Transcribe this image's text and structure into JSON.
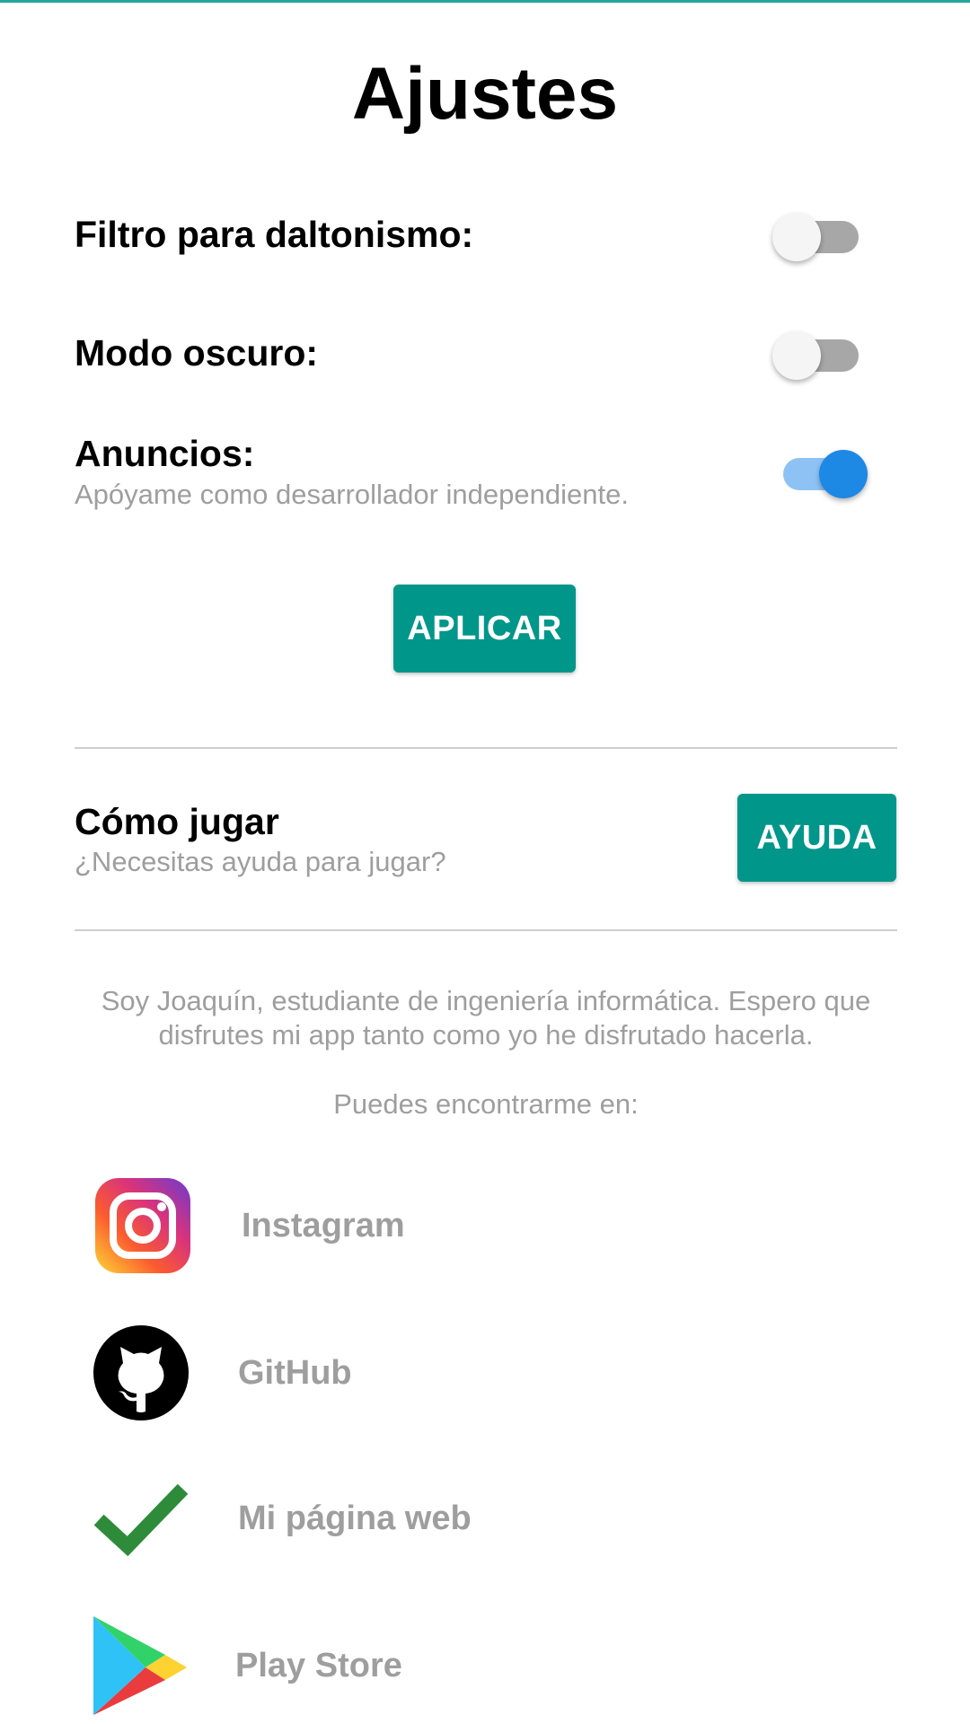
{
  "header": {
    "title": "Ajustes"
  },
  "settings": {
    "colorblind": {
      "label": "Filtro para daltonismo:",
      "enabled": false
    },
    "dark_mode": {
      "label": "Modo oscuro:",
      "enabled": false
    },
    "ads": {
      "label": "Anuncios:",
      "subtitle": "Apóyame como desarrollador independiente.",
      "enabled": true
    },
    "apply_label": "APLICAR"
  },
  "help": {
    "title": "Cómo jugar",
    "subtitle": "¿Necesitas ayuda para jugar?",
    "button_label": "AYUDA"
  },
  "about": {
    "bio": "Soy Joaquín, estudiante de ingeniería informática. Espero que disfrutes mi app tanto como yo he disfrutado hacerla.",
    "find_me": "Puedes encontrarme en:"
  },
  "links": [
    {
      "label": "Instagram",
      "icon": "instagram-icon"
    },
    {
      "label": "GitHub",
      "icon": "github-icon"
    },
    {
      "label": "Mi página web",
      "icon": "checkmark-icon"
    },
    {
      "label": "Play Store",
      "icon": "play-store-icon"
    }
  ],
  "colors": {
    "accent": "#00968a",
    "switch_on": "#1e88e5",
    "muted_text": "#9e9e9e"
  }
}
